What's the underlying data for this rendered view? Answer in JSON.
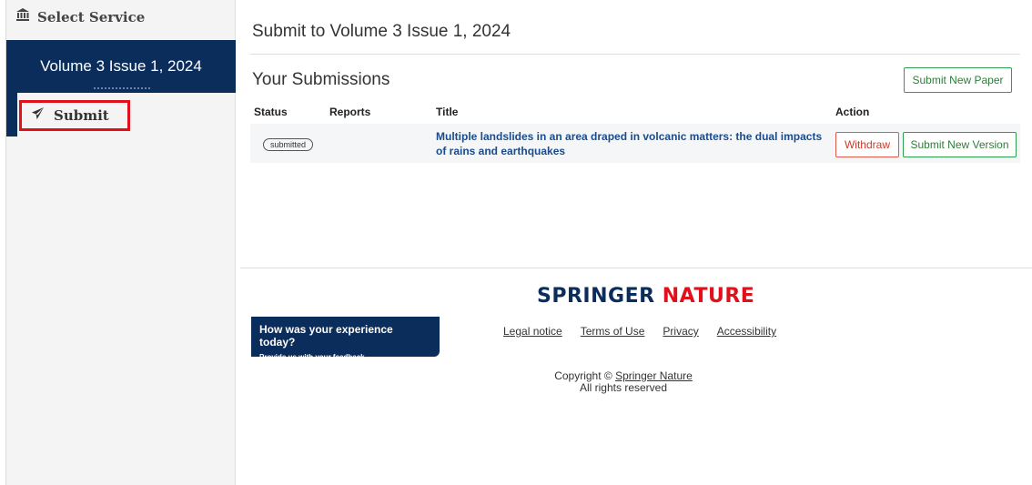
{
  "sidebar": {
    "service_label": "Select Service",
    "volume_title": "Volume 3 Issue 1, 2024",
    "submit_label": "Submit",
    "highlight_color": "#e1101a"
  },
  "main": {
    "page_title": "Submit to Volume 3 Issue 1, 2024",
    "submissions_heading": "Your Submissions",
    "new_paper_label": "Submit New Paper",
    "table": {
      "columns": [
        "Status",
        "Reports",
        "Title",
        "Action"
      ],
      "rows": [
        {
          "status": "submitted",
          "reports": "",
          "title": "Multiple landslides in an area draped in volcanic matters: the dual impacts of rains and earthquakes",
          "withdraw_label": "Withdraw",
          "new_version_label": "Submit New Version"
        }
      ]
    }
  },
  "footer": {
    "logo_part1": "SPRINGER",
    "logo_part2": "NATURE",
    "feedback_question": "How was your experience today?",
    "feedback_sub": "Provide us with your feedback.",
    "links": [
      "Legal notice",
      "Terms of Use",
      "Privacy",
      "Accessibility"
    ],
    "copyright_prefix": "Copyright ©",
    "copyright_link": "Springer Nature",
    "rights": "All rights reserved"
  },
  "colors": {
    "navy": "#0b2d5b",
    "brand_red": "#e1101a",
    "green": "#2e9e4f",
    "link_blue": "#1a4b8c"
  }
}
